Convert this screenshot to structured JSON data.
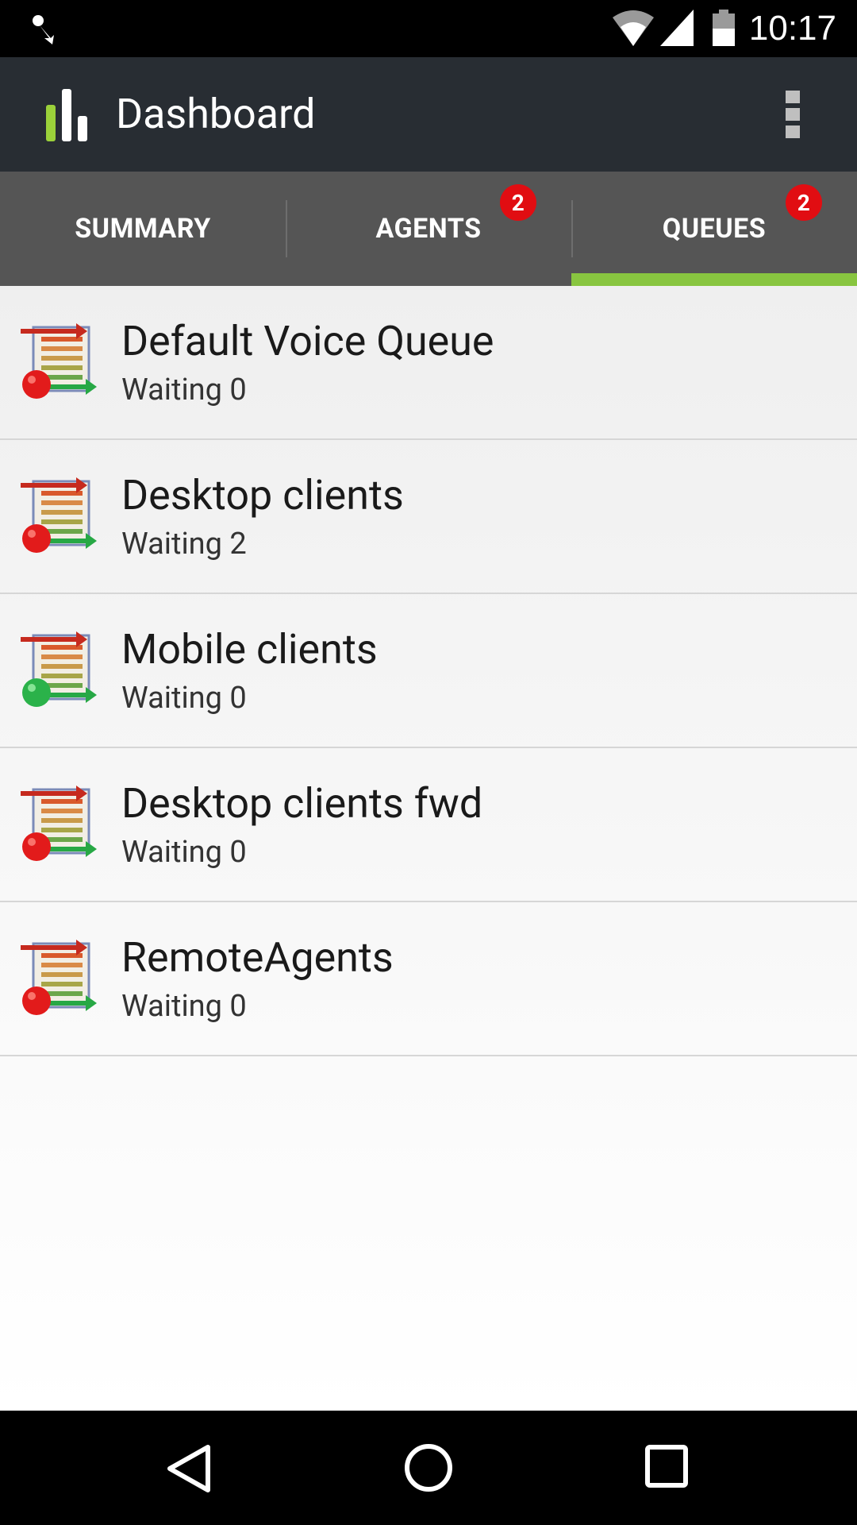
{
  "status_bar": {
    "time": "10:17",
    "icons": [
      "notification-icon",
      "wifi-icon",
      "cell-signal-icon",
      "battery-icon"
    ]
  },
  "app_bar": {
    "title": "Dashboard",
    "logo_icon": "bar-chart-logo-icon",
    "overflow_icon": "more-vert-icon"
  },
  "tabs": [
    {
      "label": "SUMMARY",
      "badge": "",
      "active": false
    },
    {
      "label": "AGENTS",
      "badge": "2",
      "active": false
    },
    {
      "label": "QUEUES",
      "badge": "2",
      "active": true
    }
  ],
  "colors": {
    "accent": "#88c540",
    "badge": "#e10d12",
    "status_red": "#e21b1b",
    "status_green": "#2bb24a"
  },
  "queues": [
    {
      "name": "Default Voice Queue",
      "waiting": "Waiting 0",
      "status": "red"
    },
    {
      "name": "Desktop clients",
      "waiting": "Waiting 2",
      "status": "red"
    },
    {
      "name": "Mobile clients",
      "waiting": "Waiting 0",
      "status": "green"
    },
    {
      "name": "Desktop clients fwd",
      "waiting": "Waiting 0",
      "status": "red"
    },
    {
      "name": "RemoteAgents",
      "waiting": "Waiting 0",
      "status": "red"
    }
  ],
  "nav_bar": {
    "icons": [
      "back-icon",
      "home-icon",
      "recent-apps-icon"
    ]
  }
}
